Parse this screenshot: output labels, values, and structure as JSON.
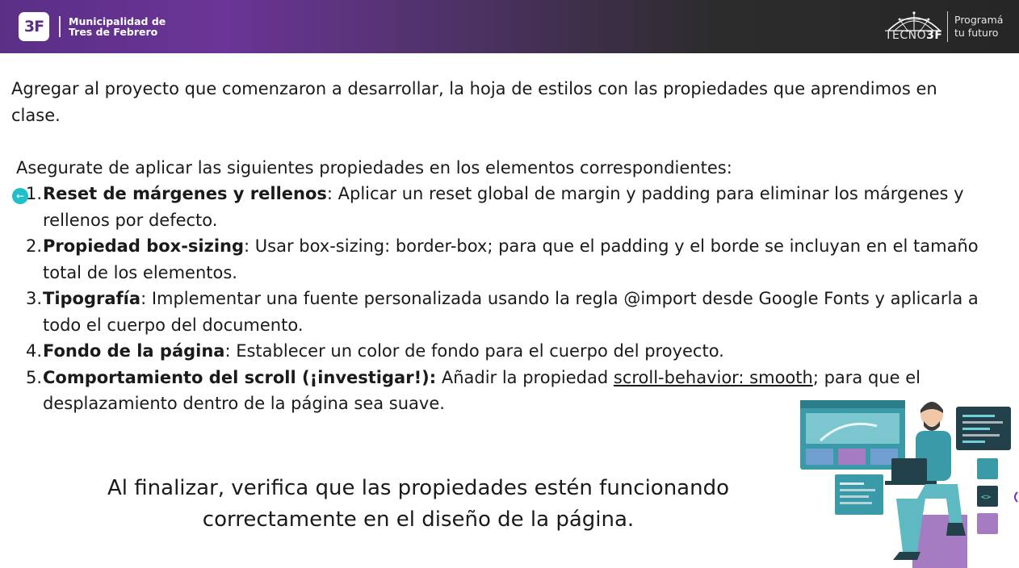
{
  "header": {
    "logo_text": "3F",
    "municipality_line1": "Municipalidad de",
    "municipality_line2": "Tres de Febrero",
    "tecno_prefix": "TECNO",
    "tecno_suffix": "3F",
    "slogan_line1": "Programá",
    "slogan_line2": "tu futuro"
  },
  "content": {
    "intro": "Agregar al proyecto que comenzaron a desarrollar, la hoja de estilos con las propiedades que aprendimos en clase.",
    "subhead": "Asegurate de aplicar las siguientes propiedades en los elementos correspondientes:",
    "items": [
      {
        "num": "1.",
        "title": "Reset de márgenes y rellenos",
        "text": ": Aplicar un reset global de margin y padding para eliminar los márgenes y rellenos por defecto."
      },
      {
        "num": "2.",
        "title": "Propiedad box-sizing",
        "text": ": Usar box-sizing: border-box; para que el padding y el borde se incluyan en el tamaño total de los elementos."
      },
      {
        "num": "3.",
        "title": "Tipografía",
        "text": ": Implementar una fuente personalizada usando la regla @import desde Google Fonts y aplicarla a todo el cuerpo del documento."
      },
      {
        "num": "4.",
        "title": "Fondo de la página",
        "text": ": Establecer un color de fondo para el cuerpo del proyecto."
      },
      {
        "num": "5.",
        "title": "Comportamiento del scroll (¡investigar!):",
        "text_before": " Añadir la propiedad ",
        "text_underlined": "scroll-behavior: smooth",
        "text_after": "; para que el desplazamiento dentro de la página sea suave."
      }
    ],
    "closing_line1": "Al finalizar, verifica que las propiedades estén funcionando",
    "closing_line2": "correctamente en el diseño de la página."
  },
  "icons": {
    "back": "arrow-left-circle-icon",
    "illustration": "developer-with-laptop-illustration"
  },
  "colors": {
    "header_purple": "#5b2f86",
    "header_dark": "#262626",
    "accent_teal": "#20c0c8"
  }
}
